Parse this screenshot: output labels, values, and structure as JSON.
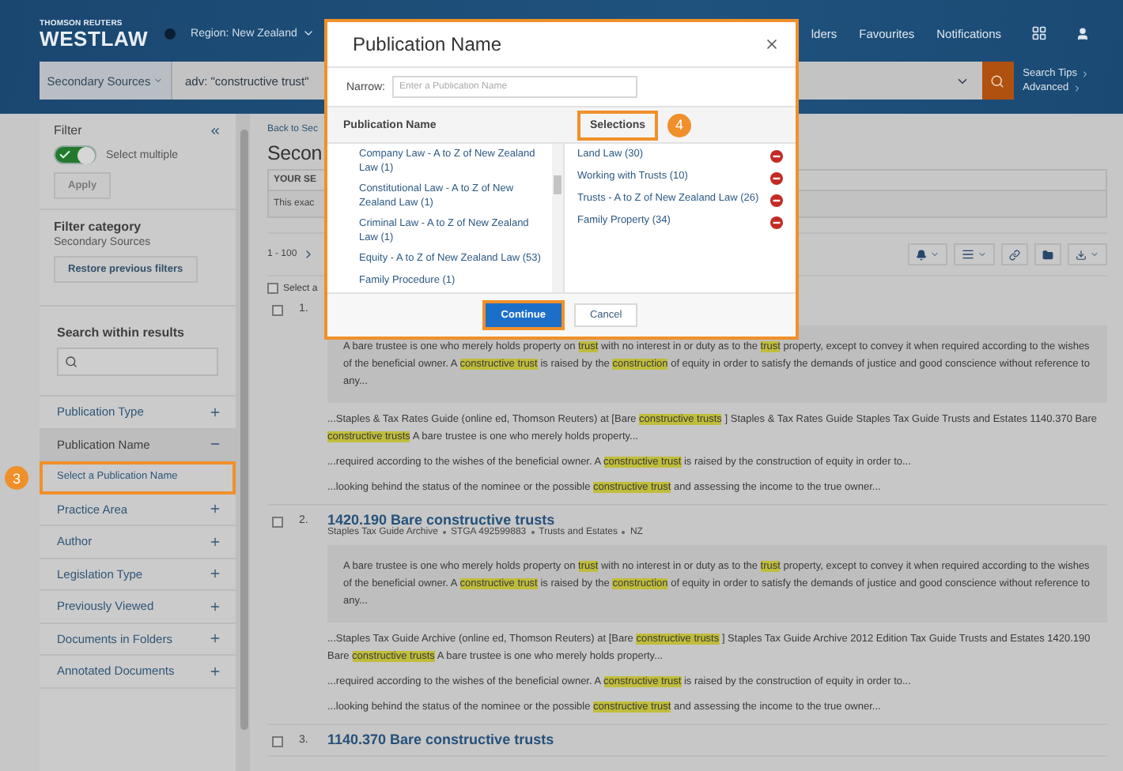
{
  "header": {
    "brand_top": "THOMSON REUTERS",
    "brand": "WESTLAW",
    "region": "Region: New Zealand",
    "nav": [
      "lders",
      "Favourites",
      "Notifications"
    ],
    "search": {
      "scope": "Secondary Sources",
      "value": "adv: \"constructive trust\""
    },
    "links": [
      "Search Tips",
      "Advanced"
    ]
  },
  "sidebar": {
    "title": "Filter",
    "toggle": {
      "label": "Select multiple",
      "on": true
    },
    "apply": {
      "label": "Apply",
      "disabled": true
    },
    "category_title": "Filter category",
    "category": "Secondary Sources",
    "restore": "Restore previous filters",
    "search_title": "Search within results",
    "facets": [
      {
        "label": "Publication Type",
        "expanded": false
      },
      {
        "label": "Publication Name",
        "expanded": true,
        "children": [
          {
            "label": "Select a Publication Name",
            "callout": "3"
          }
        ]
      },
      {
        "label": "Practice Area",
        "expanded": false
      },
      {
        "label": "Author",
        "expanded": false
      },
      {
        "label": "Legislation Type",
        "expanded": false
      },
      {
        "label": "Previously Viewed",
        "expanded": false
      },
      {
        "label": "Documents in Folders",
        "expanded": false
      },
      {
        "label": "Annotated Documents",
        "expanded": false
      }
    ]
  },
  "main": {
    "back": "Back to Sec",
    "heading": "Secon",
    "query_label": "YOUR SE",
    "query_text": "This exac",
    "range": "1 - 100",
    "select_all": {
      "label": "Select a",
      "checked": false
    },
    "results": [
      {
        "number": "1.",
        "checked": false,
        "abstract": [
          {
            "text": "A bare trustee is one who merely holds property on",
            "highlight": false
          },
          {
            "text": "trust",
            "highlight": true
          },
          {
            "text": "with no interest in or duty as to the",
            "highlight": false
          },
          {
            "text": "trust",
            "highlight": true
          },
          {
            "text": "property, except to convey it when required according to the wishes of the beneficial owner. A",
            "highlight": false
          },
          {
            "text": "constructive trust",
            "highlight": true
          },
          {
            "text": "is raised by the",
            "highlight": false
          },
          {
            "text": "construction",
            "highlight": true
          },
          {
            "text": "of equity in order to satisfy the demands of justice and good conscience without reference to any...",
            "highlight": false
          }
        ],
        "snippets": [
          [
            {
              "text": "...Staples & Tax Rates Guide (online ed, Thomson Reuters) at [Bare",
              "highlight": false
            },
            {
              "text": "constructive trusts",
              "highlight": true
            },
            {
              "text": "] Staples & Tax Rates Guide Staples Tax Guide Trusts and Estates 1140.370 Bare",
              "highlight": false
            },
            {
              "text": "constructive trusts",
              "highlight": true
            },
            {
              "text": "A bare trustee is one who merely holds property...",
              "highlight": false
            }
          ],
          [
            {
              "text": "...required according to the wishes of the beneficial owner. A",
              "highlight": false
            },
            {
              "text": "constructive trust",
              "highlight": true
            },
            {
              "text": "is raised by the construction of equity in order to...",
              "highlight": false
            }
          ],
          [
            {
              "text": "...looking behind the status of the nominee or the possible",
              "highlight": false
            },
            {
              "text": "constructive trust",
              "highlight": true
            },
            {
              "text": "and assessing the income to the true owner...",
              "highlight": false
            }
          ]
        ]
      },
      {
        "number": "2.",
        "checked": false,
        "title": "1420.190 Bare constructive trusts",
        "meta": [
          "Staples Tax Guide Archive",
          "STGA 492599883",
          "Trusts and Estates",
          "NZ"
        ],
        "abstract": [
          {
            "text": "A bare trustee is one who merely holds property on",
            "highlight": false
          },
          {
            "text": "trust",
            "highlight": true
          },
          {
            "text": "with no interest in or duty as to the",
            "highlight": false
          },
          {
            "text": "trust",
            "highlight": true
          },
          {
            "text": "property, except to convey it when required according to the wishes of the beneficial owner. A",
            "highlight": false
          },
          {
            "text": "constructive trust",
            "highlight": true
          },
          {
            "text": "is raised by the",
            "highlight": false
          },
          {
            "text": "construction",
            "highlight": true
          },
          {
            "text": "of equity in order to satisfy the demands of justice and good conscience without reference to any...",
            "highlight": false
          }
        ],
        "snippets": [
          [
            {
              "text": "...Staples Tax Guide Archive (online ed, Thomson Reuters) at [Bare",
              "highlight": false
            },
            {
              "text": "constructive trusts",
              "highlight": true
            },
            {
              "text": "] Staples Tax Guide Archive 2012 Edition Tax Guide Trusts and Estates 1420.190 Bare",
              "highlight": false
            },
            {
              "text": "constructive trusts",
              "highlight": true
            },
            {
              "text": "A bare trustee is one who merely holds property...",
              "highlight": false
            }
          ],
          [
            {
              "text": "...required according to the wishes of the beneficial owner. A",
              "highlight": false
            },
            {
              "text": "constructive trust",
              "highlight": true
            },
            {
              "text": "is raised by the construction of equity in order to...",
              "highlight": false
            }
          ],
          [
            {
              "text": "...looking behind the status of the nominee or the possible",
              "highlight": false
            },
            {
              "text": "constructive trust",
              "highlight": true
            },
            {
              "text": "and assessing the income to the true owner...",
              "highlight": false
            }
          ]
        ]
      },
      {
        "number": "3.",
        "checked": false,
        "title": "1140.370 Bare constructive trusts"
      }
    ]
  },
  "modal": {
    "title": "Publication Name",
    "narrow_label": "Narrow:",
    "placeholder": "Enter a Publication Name",
    "list_title": "Publication Name",
    "selections_title": "Selections",
    "selections_callout": "4",
    "publications": [
      "Company Law - A to Z of New Zealand Law (1)",
      "Constitutional Law - A to Z of New Zealand Law (1)",
      "Criminal Law - A to Z of New Zealand Law (1)",
      "Equity - A to Z of New Zealand Law (53)",
      "Family Procedure (1)"
    ],
    "selections": [
      "Land Law (30)",
      "Working with Trusts (10)",
      "Trusts - A to Z of New Zealand Law (26)",
      "Family Property (34)"
    ],
    "buttons": [
      {
        "label": "Continue",
        "kind": "primary",
        "highlighted": true
      },
      {
        "label": "Cancel",
        "kind": "secondary",
        "highlighted": false
      }
    ]
  }
}
